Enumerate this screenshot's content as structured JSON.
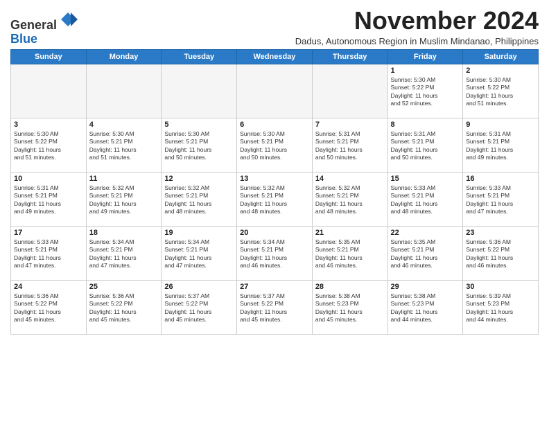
{
  "logo": {
    "general": "General",
    "blue": "Blue"
  },
  "header": {
    "month": "November 2024",
    "subtitle": "Dadus, Autonomous Region in Muslim Mindanao, Philippines"
  },
  "weekdays": [
    "Sunday",
    "Monday",
    "Tuesday",
    "Wednesday",
    "Thursday",
    "Friday",
    "Saturday"
  ],
  "weeks": [
    [
      {
        "day": "",
        "info": ""
      },
      {
        "day": "",
        "info": ""
      },
      {
        "day": "",
        "info": ""
      },
      {
        "day": "",
        "info": ""
      },
      {
        "day": "",
        "info": ""
      },
      {
        "day": "1",
        "info": "Sunrise: 5:30 AM\nSunset: 5:22 PM\nDaylight: 11 hours\nand 52 minutes."
      },
      {
        "day": "2",
        "info": "Sunrise: 5:30 AM\nSunset: 5:22 PM\nDaylight: 11 hours\nand 51 minutes."
      }
    ],
    [
      {
        "day": "3",
        "info": "Sunrise: 5:30 AM\nSunset: 5:22 PM\nDaylight: 11 hours\nand 51 minutes."
      },
      {
        "day": "4",
        "info": "Sunrise: 5:30 AM\nSunset: 5:21 PM\nDaylight: 11 hours\nand 51 minutes."
      },
      {
        "day": "5",
        "info": "Sunrise: 5:30 AM\nSunset: 5:21 PM\nDaylight: 11 hours\nand 50 minutes."
      },
      {
        "day": "6",
        "info": "Sunrise: 5:30 AM\nSunset: 5:21 PM\nDaylight: 11 hours\nand 50 minutes."
      },
      {
        "day": "7",
        "info": "Sunrise: 5:31 AM\nSunset: 5:21 PM\nDaylight: 11 hours\nand 50 minutes."
      },
      {
        "day": "8",
        "info": "Sunrise: 5:31 AM\nSunset: 5:21 PM\nDaylight: 11 hours\nand 50 minutes."
      },
      {
        "day": "9",
        "info": "Sunrise: 5:31 AM\nSunset: 5:21 PM\nDaylight: 11 hours\nand 49 minutes."
      }
    ],
    [
      {
        "day": "10",
        "info": "Sunrise: 5:31 AM\nSunset: 5:21 PM\nDaylight: 11 hours\nand 49 minutes."
      },
      {
        "day": "11",
        "info": "Sunrise: 5:32 AM\nSunset: 5:21 PM\nDaylight: 11 hours\nand 49 minutes."
      },
      {
        "day": "12",
        "info": "Sunrise: 5:32 AM\nSunset: 5:21 PM\nDaylight: 11 hours\nand 48 minutes."
      },
      {
        "day": "13",
        "info": "Sunrise: 5:32 AM\nSunset: 5:21 PM\nDaylight: 11 hours\nand 48 minutes."
      },
      {
        "day": "14",
        "info": "Sunrise: 5:32 AM\nSunset: 5:21 PM\nDaylight: 11 hours\nand 48 minutes."
      },
      {
        "day": "15",
        "info": "Sunrise: 5:33 AM\nSunset: 5:21 PM\nDaylight: 11 hours\nand 48 minutes."
      },
      {
        "day": "16",
        "info": "Sunrise: 5:33 AM\nSunset: 5:21 PM\nDaylight: 11 hours\nand 47 minutes."
      }
    ],
    [
      {
        "day": "17",
        "info": "Sunrise: 5:33 AM\nSunset: 5:21 PM\nDaylight: 11 hours\nand 47 minutes."
      },
      {
        "day": "18",
        "info": "Sunrise: 5:34 AM\nSunset: 5:21 PM\nDaylight: 11 hours\nand 47 minutes."
      },
      {
        "day": "19",
        "info": "Sunrise: 5:34 AM\nSunset: 5:21 PM\nDaylight: 11 hours\nand 47 minutes."
      },
      {
        "day": "20",
        "info": "Sunrise: 5:34 AM\nSunset: 5:21 PM\nDaylight: 11 hours\nand 46 minutes."
      },
      {
        "day": "21",
        "info": "Sunrise: 5:35 AM\nSunset: 5:21 PM\nDaylight: 11 hours\nand 46 minutes."
      },
      {
        "day": "22",
        "info": "Sunrise: 5:35 AM\nSunset: 5:21 PM\nDaylight: 11 hours\nand 46 minutes."
      },
      {
        "day": "23",
        "info": "Sunrise: 5:36 AM\nSunset: 5:22 PM\nDaylight: 11 hours\nand 46 minutes."
      }
    ],
    [
      {
        "day": "24",
        "info": "Sunrise: 5:36 AM\nSunset: 5:22 PM\nDaylight: 11 hours\nand 45 minutes."
      },
      {
        "day": "25",
        "info": "Sunrise: 5:36 AM\nSunset: 5:22 PM\nDaylight: 11 hours\nand 45 minutes."
      },
      {
        "day": "26",
        "info": "Sunrise: 5:37 AM\nSunset: 5:22 PM\nDaylight: 11 hours\nand 45 minutes."
      },
      {
        "day": "27",
        "info": "Sunrise: 5:37 AM\nSunset: 5:22 PM\nDaylight: 11 hours\nand 45 minutes."
      },
      {
        "day": "28",
        "info": "Sunrise: 5:38 AM\nSunset: 5:23 PM\nDaylight: 11 hours\nand 45 minutes."
      },
      {
        "day": "29",
        "info": "Sunrise: 5:38 AM\nSunset: 5:23 PM\nDaylight: 11 hours\nand 44 minutes."
      },
      {
        "day": "30",
        "info": "Sunrise: 5:39 AM\nSunset: 5:23 PM\nDaylight: 11 hours\nand 44 minutes."
      }
    ]
  ]
}
